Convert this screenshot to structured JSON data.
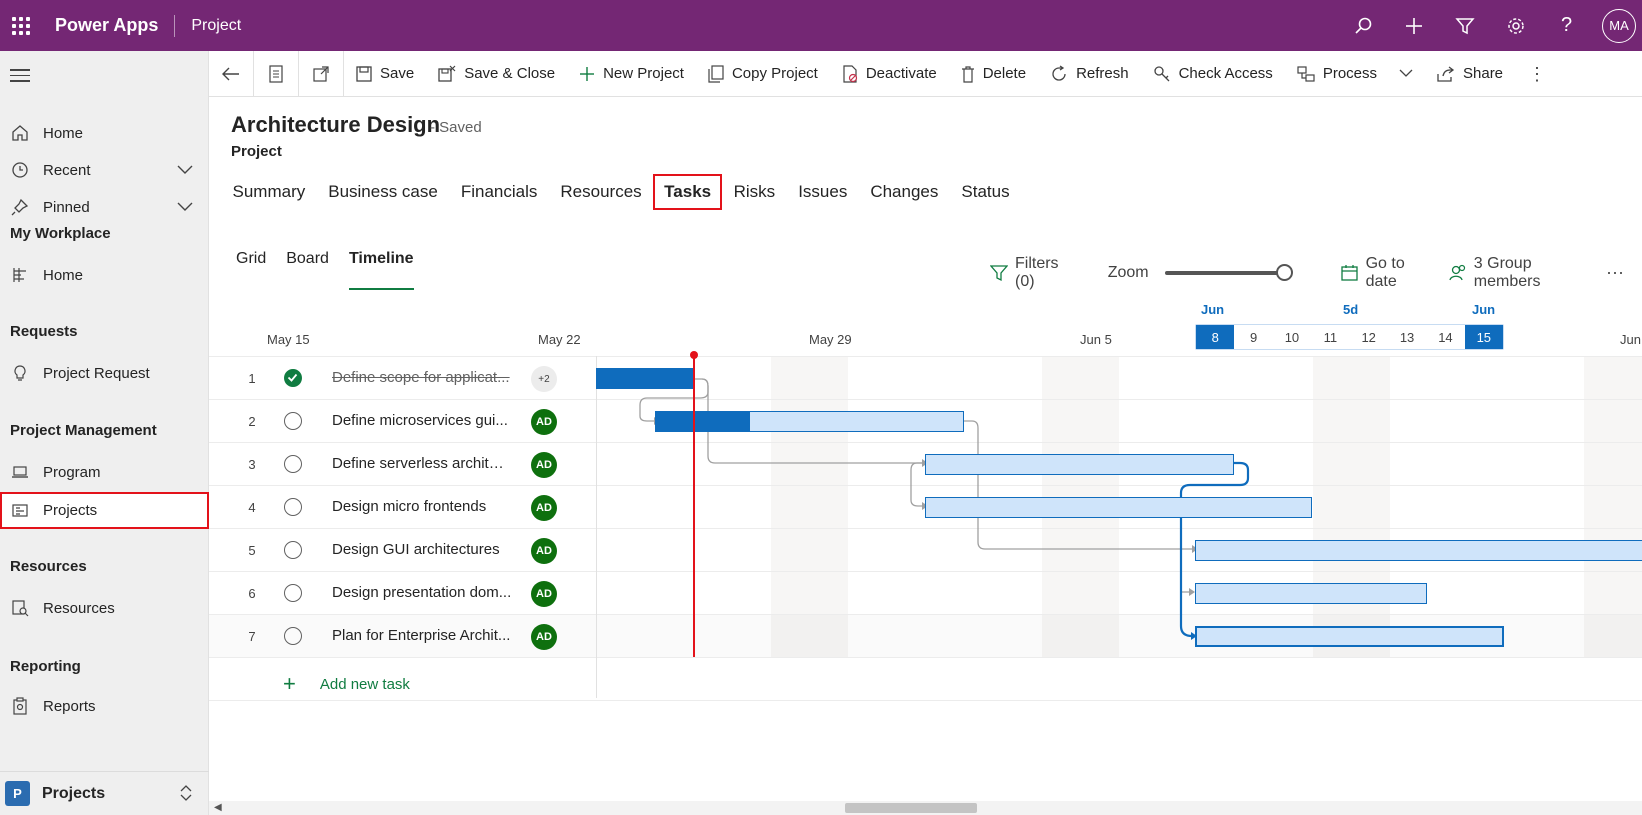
{
  "topbar": {
    "app_name": "Power Apps",
    "area_name": "Project",
    "user_initials": "MA"
  },
  "sidebar": {
    "items_top": [
      {
        "label": "Home",
        "icon": "home-icon"
      },
      {
        "label": "Recent",
        "icon": "clock-icon"
      },
      {
        "label": "Pinned",
        "icon": "pin-icon"
      }
    ],
    "sections": [
      {
        "title": "My Workplace",
        "items": [
          {
            "label": "Home",
            "icon": "dashboard-icon"
          }
        ]
      },
      {
        "title": "Requests",
        "items": [
          {
            "label": "Project Request",
            "icon": "lightbulb-icon"
          }
        ]
      },
      {
        "title": "Project Management",
        "items": [
          {
            "label": "Program",
            "icon": "laptop-icon"
          },
          {
            "label": "Projects",
            "icon": "projects-icon"
          }
        ]
      },
      {
        "title": "Resources",
        "items": [
          {
            "label": "Resources",
            "icon": "resources-icon"
          }
        ]
      },
      {
        "title": "Reporting",
        "items": [
          {
            "label": "Reports",
            "icon": "reports-icon"
          }
        ]
      }
    ],
    "area_switcher": {
      "badge": "P",
      "label": "Projects"
    }
  },
  "commandbar": {
    "save": "Save",
    "save_close": "Save & Close",
    "new_project": "New Project",
    "copy_project": "Copy Project",
    "deactivate": "Deactivate",
    "delete": "Delete",
    "refresh": "Refresh",
    "check_access": "Check Access",
    "process": "Process",
    "share": "Share"
  },
  "record": {
    "title": "Architecture Design",
    "saved_status": "- Saved",
    "entity": "Project"
  },
  "tabs": [
    "Summary",
    "Business case",
    "Financials",
    "Resources",
    "Tasks",
    "Risks",
    "Issues",
    "Changes",
    "Status"
  ],
  "active_tab": "Tasks",
  "views": {
    "grid": "Grid",
    "board": "Board",
    "timeline": "Timeline",
    "active": "Timeline"
  },
  "tools": {
    "filters": "Filters (0)",
    "zoom": "Zoom",
    "zoom_level": 1.0,
    "go_to_date": "Go to date",
    "group_members": "3 Group members"
  },
  "timeline": {
    "date_labels": [
      "May 15",
      "May 22",
      "May 29",
      "Jun 5",
      "Jun"
    ],
    "month_labels": [
      "Jun",
      "5d",
      "Jun"
    ],
    "week_days": [
      "8",
      "9",
      "10",
      "11",
      "12",
      "13",
      "14",
      "15"
    ],
    "selected_days": [
      "8",
      "15"
    ]
  },
  "tasks": [
    {
      "num": "1",
      "name": "Define scope for applicat...",
      "done": true,
      "assignee": "+2"
    },
    {
      "num": "2",
      "name": "Define microservices gui...",
      "done": false,
      "assignee": "AD"
    },
    {
      "num": "3",
      "name": "Define serverless architec...",
      "done": false,
      "assignee": "AD"
    },
    {
      "num": "4",
      "name": "Design micro frontends",
      "done": false,
      "assignee": "AD"
    },
    {
      "num": "5",
      "name": "Design GUI architectures",
      "done": false,
      "assignee": "AD"
    },
    {
      "num": "6",
      "name": "Design presentation dom...",
      "done": false,
      "assignee": "AD"
    },
    {
      "num": "7",
      "name": "Plan for Enterprise Archit...",
      "done": false,
      "assignee": "AD"
    }
  ],
  "add_task_label": "Add new task",
  "colors": {
    "brand": "#742774",
    "accent": "#0f6cbd",
    "success": "#107c41",
    "highlight": "#e3121a"
  }
}
